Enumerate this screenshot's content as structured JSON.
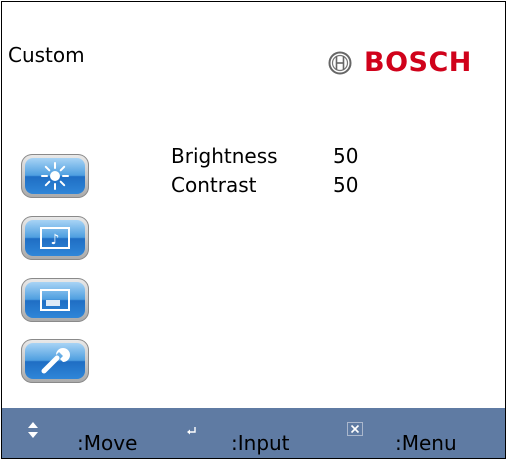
{
  "header": {
    "title": "Custom",
    "brand": "BOSCH"
  },
  "colors": {
    "brand_red": "#d0021b",
    "footer_bg": "#5f7ba3",
    "icon_blue": "#2f86d8"
  },
  "sidebar": {
    "icons": [
      {
        "name": "brightness-icon"
      },
      {
        "name": "audio-icon"
      },
      {
        "name": "display-icon"
      },
      {
        "name": "wrench-icon"
      }
    ]
  },
  "settings": {
    "rows": [
      {
        "label": "Brightness",
        "value": "50"
      },
      {
        "label": "Contrast",
        "value": "50"
      }
    ]
  },
  "footer": {
    "move": {
      "icon": "up-down-arrows-icon",
      "label": ":Move"
    },
    "input": {
      "icon": "enter-icon",
      "label": ":Input"
    },
    "menu": {
      "icon": "close-icon",
      "label": ":Menu"
    }
  }
}
